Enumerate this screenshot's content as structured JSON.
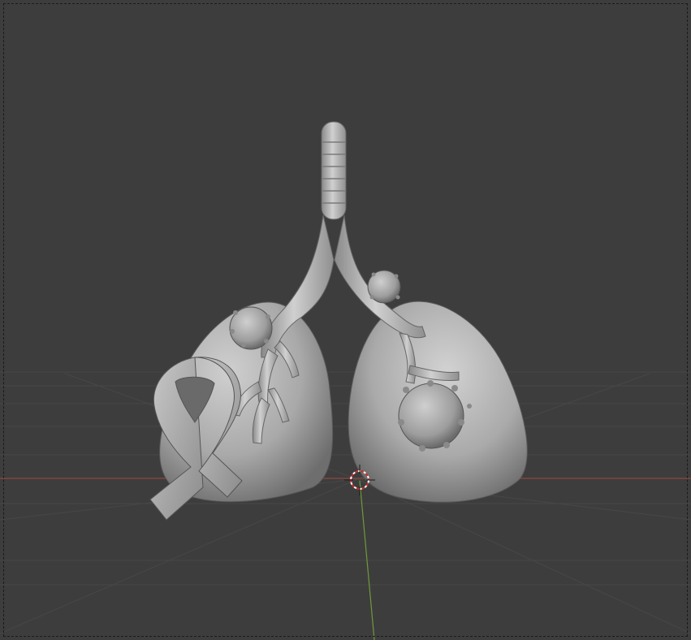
{
  "app": {
    "name": "3D viewport",
    "mode": "solid-shading"
  },
  "viewport": {
    "background_color": "#3d3d3d",
    "grid_color": "#474747",
    "x_axis_color": "#8a4a3f",
    "y_axis_color": "#6f9a3a"
  },
  "scene": {
    "objects": [
      {
        "name": "trachea",
        "icon": "trachea-icon"
      },
      {
        "name": "left-lung",
        "icon": "lung-icon"
      },
      {
        "name": "right-lung",
        "icon": "lung-icon"
      },
      {
        "name": "bronchi",
        "icon": "bronchi-icon"
      },
      {
        "name": "virus-particles",
        "icon": "virus-icon"
      },
      {
        "name": "awareness-ribbon",
        "icon": "ribbon-icon"
      }
    ],
    "cursor": {
      "icon": "3d-cursor-icon"
    }
  }
}
